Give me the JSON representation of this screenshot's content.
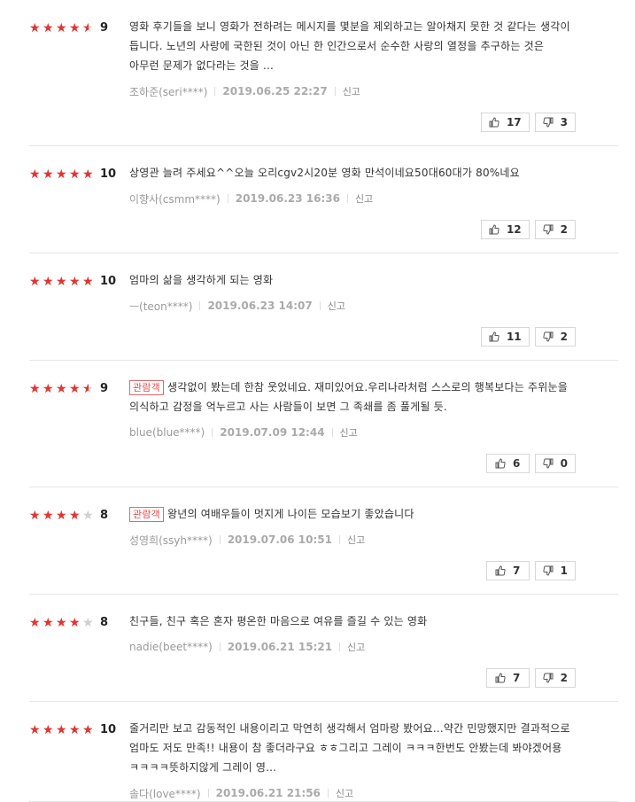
{
  "colors": {
    "star_on": "#e53333",
    "star_off": "#cfcfcf",
    "badge": "#e24b4b"
  },
  "icons": {
    "like": "thumbs-up-icon",
    "dislike": "thumbs-down-icon",
    "star": "star-icon"
  },
  "reviews": [
    {
      "rating": 9,
      "score_label": "9",
      "badge": "",
      "text": "영화 후기들을 보니 영화가 전하려는 메시지를 몇분을 제외하고는 알아채지 못한 것 같다는 생각이 듭니다. 노년의 사랑에 국한된 것이 아닌 한 인간으로서 순수한 사랑의 열정을 추구하는 것은 아무런 문제가 없다라는 것을 ...",
      "author": "조하준(seri****)",
      "date": "2019.06.25 22:27",
      "report_label": "신고",
      "likes": "17",
      "dislikes": "3"
    },
    {
      "rating": 10,
      "score_label": "10",
      "badge": "",
      "text": "상영관 늘려 주세요^^오늘 오리cgv2시20분 영화 만석이네요50대60대가 80%네요",
      "author": "이향사(csmm****)",
      "date": "2019.06.23 16:36",
      "report_label": "신고",
      "likes": "12",
      "dislikes": "2"
    },
    {
      "rating": 10,
      "score_label": "10",
      "badge": "",
      "text": "엄마의 삶을 생각하게 되는 영화",
      "author": "ㅡ(teon****)",
      "date": "2019.06.23 14:07",
      "report_label": "신고",
      "likes": "11",
      "dislikes": "2"
    },
    {
      "rating": 9,
      "score_label": "9",
      "badge": "관람객",
      "text": "생각없이 봤는데 한참 웃었네요. 재미있어요.우리나라처럼 스스로의 행복보다는 주위눈을 의식하고 감정을 억누르고 사는 사람들이 보면 그 족쇄를 좀 풀게될 듯.",
      "author": "blue(blue****)",
      "date": "2019.07.09 12:44",
      "report_label": "신고",
      "likes": "6",
      "dislikes": "0"
    },
    {
      "rating": 8,
      "score_label": "8",
      "badge": "관람객",
      "text": "왕년의 여배우들이 멋지게 나이든 모습보기 좋았습니다",
      "author": "성영희(ssyh****)",
      "date": "2019.07.06 10:51",
      "report_label": "신고",
      "likes": "7",
      "dislikes": "1"
    },
    {
      "rating": 8,
      "score_label": "8",
      "badge": "",
      "text": "친구들, 친구 혹은 혼자 평온한 마음으로 여유를 즐길 수 있는 영화",
      "author": "nadie(beet****)",
      "date": "2019.06.21 15:21",
      "report_label": "신고",
      "likes": "7",
      "dislikes": "2"
    },
    {
      "rating": 10,
      "score_label": "10",
      "badge": "",
      "text": "줄거리만 보고 감동적인 내용이리고 막연히 생각해서 엄마랑 봤어요...약간 민망했지만 결과적으로 엄마도 저도 만족!! 내용이 참 좋더라구요 ㅎㅎ그리고 그레이 ㅋㅋㅋ한번도 안봤는데 봐야겠어용 ㅋㅋㅋㅋ뜻하지않게 그레이 영...",
      "author": "솔다(love****)",
      "date": "2019.06.21 21:56",
      "report_label": "신고",
      "likes": "",
      "dislikes": ""
    }
  ]
}
